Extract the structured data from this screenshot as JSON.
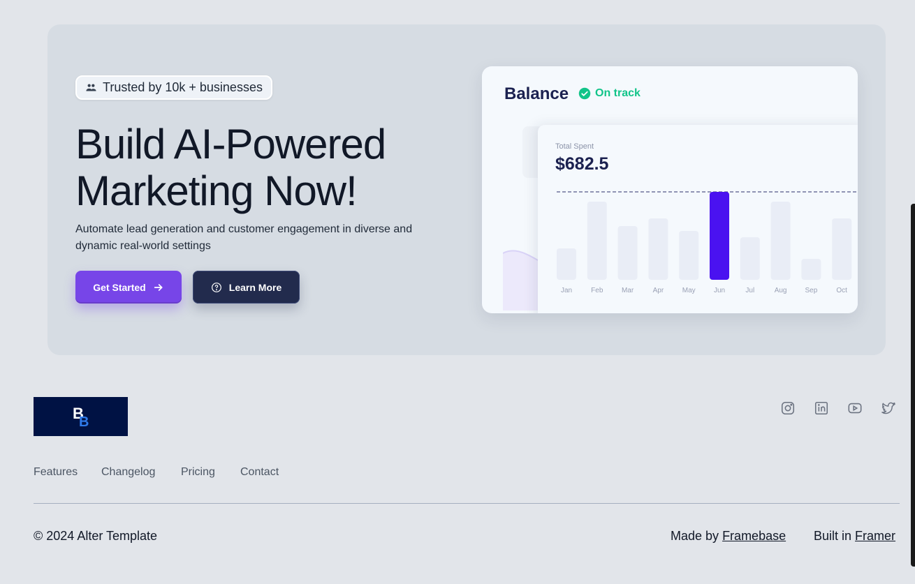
{
  "hero": {
    "badge_text": "Trusted by 10k + businesses",
    "headline_line1": "Build AI-Powered",
    "headline_line2": "Marketing Now!",
    "subtitle": "Automate lead generation and customer engagement in diverse and dynamic real-world settings",
    "primary_button": "Get Started",
    "secondary_button": "Learn More"
  },
  "balance_card": {
    "title": "Balance",
    "status": "On track",
    "total_label": "Total Spent",
    "total_value": "$682.5"
  },
  "chart_data": {
    "type": "bar",
    "categories": [
      "Jan",
      "Feb",
      "Mar",
      "Apr",
      "May",
      "Jun",
      "Jul",
      "Aug",
      "Sep",
      "Oct"
    ],
    "values": [
      45,
      112,
      77,
      88,
      70,
      126,
      61,
      112,
      30,
      88
    ],
    "highlight": "Jun",
    "ylim": [
      0,
      126
    ],
    "colors": {
      "bar": "#e9edf6",
      "highlight": "#4a12f0",
      "reference_line": "#2b2f6b"
    }
  },
  "footer": {
    "logo_text": "BB",
    "nav": [
      "Features",
      "Changelog",
      "Pricing",
      "Contact"
    ],
    "social_icons": [
      "instagram-icon",
      "linkedin-icon",
      "youtube-icon",
      "twitter-icon"
    ],
    "copyright": "© 2024 Alter Template",
    "made_by_prefix": "Made by",
    "made_by_link": "Framebase",
    "built_in_prefix": "Built in",
    "built_in_link": "Framer"
  },
  "colors": {
    "accent": "#7745e8",
    "dark_button": "#222b4d",
    "status_green": "#12c489",
    "logo_bg": "#001244"
  }
}
